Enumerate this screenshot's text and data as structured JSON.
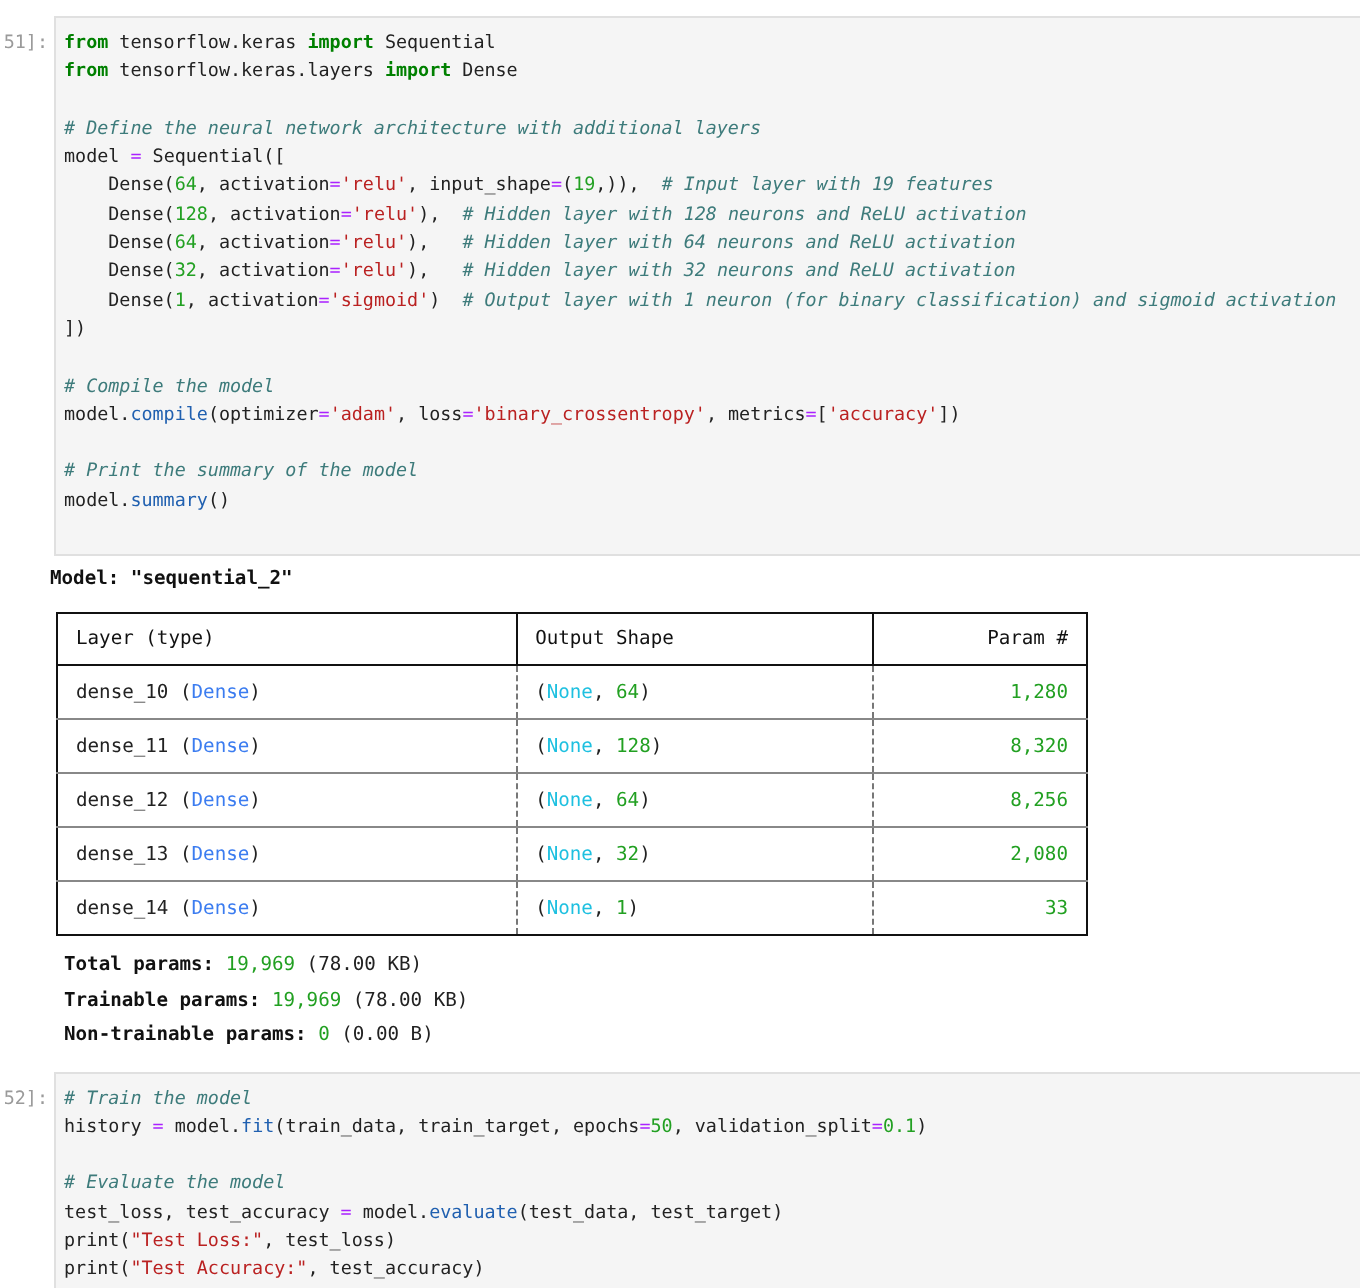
{
  "cells": [
    {
      "prompt": "51]:",
      "blocks": [
        [
          [
            {
              "kind": "kw",
              "t": "from"
            },
            {
              "kind": "p",
              "t": " tensorflow.keras "
            },
            {
              "kind": "kw",
              "t": "import"
            },
            {
              "kind": "p",
              "t": " Sequential"
            }
          ],
          [
            {
              "kind": "kw",
              "t": "from"
            },
            {
              "kind": "p",
              "t": " tensorflow.keras.layers "
            },
            {
              "kind": "kw",
              "t": "import"
            },
            {
              "kind": "p",
              "t": " Dense"
            }
          ]
        ],
        [
          [
            {
              "kind": "com",
              "t": "# Define the neural network architecture with additional layers"
            }
          ],
          [
            {
              "kind": "p",
              "t": "model "
            },
            {
              "kind": "op",
              "t": "="
            },
            {
              "kind": "p",
              "t": " Sequential(["
            }
          ],
          [
            {
              "kind": "p",
              "t": "    Dense("
            },
            {
              "kind": "num",
              "t": "64"
            },
            {
              "kind": "p",
              "t": ", activation"
            },
            {
              "kind": "op",
              "t": "="
            },
            {
              "kind": "str",
              "t": "'relu'"
            },
            {
              "kind": "p",
              "t": ", input_shape"
            },
            {
              "kind": "op",
              "t": "="
            },
            {
              "kind": "p",
              "t": "("
            },
            {
              "kind": "num",
              "t": "19"
            },
            {
              "kind": "p",
              "t": ",)),  "
            },
            {
              "kind": "com",
              "t": "# Input layer with 19 features"
            }
          ],
          [
            {
              "kind": "p",
              "t": "    Dense("
            },
            {
              "kind": "num",
              "t": "128"
            },
            {
              "kind": "p",
              "t": ", activation"
            },
            {
              "kind": "op",
              "t": "="
            },
            {
              "kind": "str",
              "t": "'relu'"
            },
            {
              "kind": "p",
              "t": "),  "
            },
            {
              "kind": "com",
              "t": "# Hidden layer with 128 neurons and ReLU activation"
            }
          ],
          [
            {
              "kind": "p",
              "t": "    Dense("
            },
            {
              "kind": "num",
              "t": "64"
            },
            {
              "kind": "p",
              "t": ", activation"
            },
            {
              "kind": "op",
              "t": "="
            },
            {
              "kind": "str",
              "t": "'relu'"
            },
            {
              "kind": "p",
              "t": "),   "
            },
            {
              "kind": "com",
              "t": "# Hidden layer with 64 neurons and ReLU activation"
            }
          ],
          [
            {
              "kind": "p",
              "t": "    Dense("
            },
            {
              "kind": "num",
              "t": "32"
            },
            {
              "kind": "p",
              "t": ", activation"
            },
            {
              "kind": "op",
              "t": "="
            },
            {
              "kind": "str",
              "t": "'relu'"
            },
            {
              "kind": "p",
              "t": "),   "
            },
            {
              "kind": "com",
              "t": "# Hidden layer with 32 neurons and ReLU activation"
            }
          ],
          [
            {
              "kind": "p",
              "t": "    Dense("
            },
            {
              "kind": "num",
              "t": "1"
            },
            {
              "kind": "p",
              "t": ", activation"
            },
            {
              "kind": "op",
              "t": "="
            },
            {
              "kind": "str",
              "t": "'sigmoid'"
            },
            {
              "kind": "p",
              "t": ")  "
            },
            {
              "kind": "com",
              "t": "# Output layer with 1 neuron (for binary classification) and sigmoid activation"
            }
          ],
          [
            {
              "kind": "p",
              "t": "])"
            }
          ]
        ],
        [
          [
            {
              "kind": "com",
              "t": "# Compile the model"
            }
          ],
          [
            {
              "kind": "p",
              "t": "model."
            },
            {
              "kind": "fn",
              "t": "compile"
            },
            {
              "kind": "p",
              "t": "(optimizer"
            },
            {
              "kind": "op",
              "t": "="
            },
            {
              "kind": "str",
              "t": "'adam'"
            },
            {
              "kind": "p",
              "t": ", loss"
            },
            {
              "kind": "op",
              "t": "="
            },
            {
              "kind": "str",
              "t": "'binary_crossentropy'"
            },
            {
              "kind": "p",
              "t": ", metrics"
            },
            {
              "kind": "op",
              "t": "="
            },
            {
              "kind": "p",
              "t": "["
            },
            {
              "kind": "str",
              "t": "'accuracy'"
            },
            {
              "kind": "p",
              "t": "])"
            }
          ]
        ],
        [
          [
            {
              "kind": "com",
              "t": "# Print the summary of the model"
            }
          ],
          [
            {
              "kind": "p",
              "t": "model."
            },
            {
              "kind": "fn",
              "t": "summary"
            },
            {
              "kind": "p",
              "t": "()"
            }
          ]
        ]
      ],
      "output": {
        "title": "Model: \"sequential_2\"",
        "table": {
          "columns": [
            "Layer (type)",
            "Output Shape",
            "Param #"
          ],
          "rows": [
            [
              [
                {
                  "kind": "p",
                  "t": "dense_10 ("
                },
                {
                  "kind": "cls",
                  "t": "Dense"
                },
                {
                  "kind": "p",
                  "t": ")"
                }
              ],
              [
                {
                  "kind": "p",
                  "t": "("
                },
                {
                  "kind": "none",
                  "t": "None"
                },
                {
                  "kind": "p",
                  "t": ", "
                },
                {
                  "kind": "num",
                  "t": "64"
                },
                {
                  "kind": "p",
                  "t": ")"
                }
              ],
              [
                {
                  "kind": "num",
                  "t": "1,280"
                }
              ]
            ],
            [
              [
                {
                  "kind": "p",
                  "t": "dense_11 ("
                },
                {
                  "kind": "cls",
                  "t": "Dense"
                },
                {
                  "kind": "p",
                  "t": ")"
                }
              ],
              [
                {
                  "kind": "p",
                  "t": "("
                },
                {
                  "kind": "none",
                  "t": "None"
                },
                {
                  "kind": "p",
                  "t": ", "
                },
                {
                  "kind": "num",
                  "t": "128"
                },
                {
                  "kind": "p",
                  "t": ")"
                }
              ],
              [
                {
                  "kind": "num",
                  "t": "8,320"
                }
              ]
            ],
            [
              [
                {
                  "kind": "p",
                  "t": "dense_12 ("
                },
                {
                  "kind": "cls",
                  "t": "Dense"
                },
                {
                  "kind": "p",
                  "t": ")"
                }
              ],
              [
                {
                  "kind": "p",
                  "t": "("
                },
                {
                  "kind": "none",
                  "t": "None"
                },
                {
                  "kind": "p",
                  "t": ", "
                },
                {
                  "kind": "num",
                  "t": "64"
                },
                {
                  "kind": "p",
                  "t": ")"
                }
              ],
              [
                {
                  "kind": "num",
                  "t": "8,256"
                }
              ]
            ],
            [
              [
                {
                  "kind": "p",
                  "t": "dense_13 ("
                },
                {
                  "kind": "cls",
                  "t": "Dense"
                },
                {
                  "kind": "p",
                  "t": ")"
                }
              ],
              [
                {
                  "kind": "p",
                  "t": "("
                },
                {
                  "kind": "none",
                  "t": "None"
                },
                {
                  "kind": "p",
                  "t": ", "
                },
                {
                  "kind": "num",
                  "t": "32"
                },
                {
                  "kind": "p",
                  "t": ")"
                }
              ],
              [
                {
                  "kind": "num",
                  "t": "2,080"
                }
              ]
            ],
            [
              [
                {
                  "kind": "p",
                  "t": "dense_14 ("
                },
                {
                  "kind": "cls",
                  "t": "Dense"
                },
                {
                  "kind": "p",
                  "t": ")"
                }
              ],
              [
                {
                  "kind": "p",
                  "t": "("
                },
                {
                  "kind": "none",
                  "t": "None"
                },
                {
                  "kind": "p",
                  "t": ", "
                },
                {
                  "kind": "num",
                  "t": "1"
                },
                {
                  "kind": "p",
                  "t": ")"
                }
              ],
              [
                {
                  "kind": "num",
                  "t": "33"
                }
              ]
            ]
          ]
        },
        "summary": [
          [
            {
              "kind": "label",
              "t": "Total params: "
            },
            {
              "kind": "num",
              "t": "19,969"
            },
            {
              "kind": "p",
              "t": " (78.00 KB)"
            }
          ],
          [
            {
              "kind": "label",
              "t": "Trainable params: "
            },
            {
              "kind": "num",
              "t": "19,969"
            },
            {
              "kind": "p",
              "t": " (78.00 KB)"
            }
          ],
          [
            {
              "kind": "label",
              "t": "Non-trainable params: "
            },
            {
              "kind": "num",
              "t": "0"
            },
            {
              "kind": "p",
              "t": " (0.00 B)"
            }
          ]
        ]
      }
    },
    {
      "prompt": "52]:",
      "blocks": [
        [
          [
            {
              "kind": "com",
              "t": "# Train the model"
            }
          ],
          [
            {
              "kind": "p",
              "t": "history "
            },
            {
              "kind": "op",
              "t": "="
            },
            {
              "kind": "p",
              "t": " model."
            },
            {
              "kind": "fn",
              "t": "fit"
            },
            {
              "kind": "p",
              "t": "(train_data, train_target, epochs"
            },
            {
              "kind": "op",
              "t": "="
            },
            {
              "kind": "num",
              "t": "50"
            },
            {
              "kind": "p",
              "t": ", validation_split"
            },
            {
              "kind": "op",
              "t": "="
            },
            {
              "kind": "num",
              "t": "0.1"
            },
            {
              "kind": "p",
              "t": ")"
            }
          ]
        ],
        [
          [
            {
              "kind": "com",
              "t": "# Evaluate the model"
            }
          ],
          [
            {
              "kind": "p",
              "t": "test_loss, test_accuracy "
            },
            {
              "kind": "op",
              "t": "="
            },
            {
              "kind": "p",
              "t": " model."
            },
            {
              "kind": "fn",
              "t": "evaluate"
            },
            {
              "kind": "p",
              "t": "(test_data, test_target)"
            }
          ],
          [
            {
              "kind": "p",
              "t": "print("
            },
            {
              "kind": "str",
              "t": "\"Test Loss:\""
            },
            {
              "kind": "p",
              "t": ", test_loss)"
            }
          ],
          [
            {
              "kind": "p",
              "t": "print("
            },
            {
              "kind": "str",
              "t": "\"Test Accuracy:\""
            },
            {
              "kind": "p",
              "t": ", test_accuracy)"
            }
          ]
        ]
      ]
    }
  ]
}
